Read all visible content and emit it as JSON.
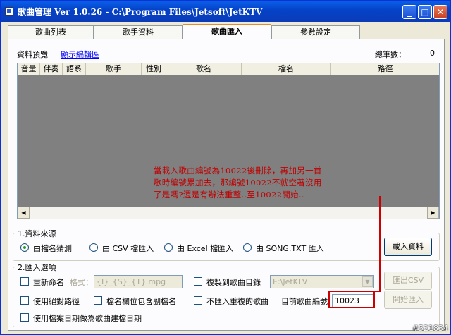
{
  "window": {
    "title": "歌曲管理  Ver 1.0.26 - C:\\Program Files\\Jetsoft\\JetKTV",
    "minimize": "_",
    "maximize": "□",
    "close": "✕"
  },
  "tabs": [
    {
      "label": "歌曲列表"
    },
    {
      "label": "歌手資料"
    },
    {
      "label": "歌曲匯入"
    },
    {
      "label": "參數設定"
    }
  ],
  "preview": {
    "label": "資料預覽",
    "show_edit_link": "顯示編輯區",
    "total_label": "總筆數：",
    "total_value": "0"
  },
  "columns": [
    "音量",
    "伴奏",
    "語系",
    "歌手",
    "性別",
    "歌名",
    "檔名",
    "路徑"
  ],
  "annotation": {
    "line1": "當載入歌曲編號為10022後刪除，再加另一首",
    "line2": "歌時編號累加去，那編號10022不就空著沒用",
    "line3": "了是嗎?還是有辦法重整..至10022開始.."
  },
  "source_group": {
    "title": "1.資料來源",
    "options": [
      "由檔名猜測",
      "由 CSV 檔匯入",
      "由 Excel 檔匯入",
      "由 SONG.TXT 匯入"
    ],
    "selected_index": 0,
    "load_button": "載入資料"
  },
  "import_group": {
    "title": "2.匯入選項",
    "rename_label": "重新命名",
    "format_label": "格式：",
    "format_value": "{I}_{S}_{T}.mpg",
    "copy_label": "複製到歌曲目錄",
    "copy_path": "E:\\JetKTV",
    "export_csv_button": "匯出CSV",
    "absolute_path_label": "使用絕對路徑",
    "subname_label": "檔名欄位包含副檔名",
    "no_duplicate_label": "不匯入重複的歌曲",
    "current_number_label": "目前歌曲編號",
    "current_number_value": "10023",
    "start_import_button": "開始匯入",
    "use_file_date_label": "使用檔案日期做為歌曲建檔日期"
  },
  "watermark": "#521834"
}
